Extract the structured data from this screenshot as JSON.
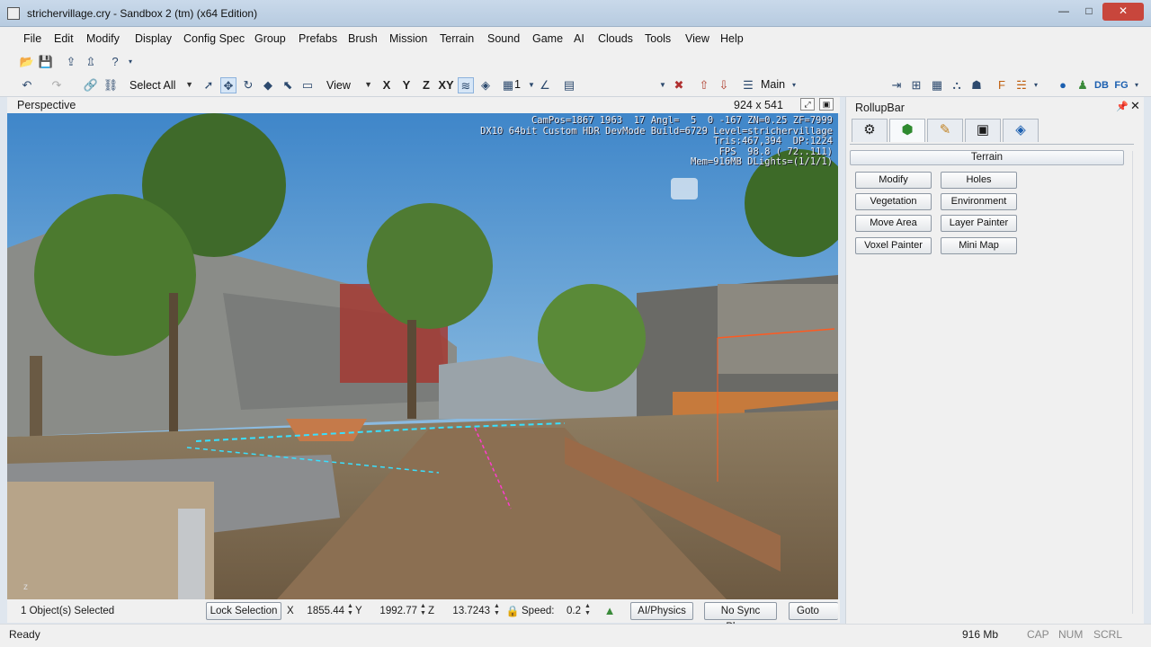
{
  "window": {
    "title": "strichervillage.cry - Sandbox 2 (tm) (x64 Edition)",
    "min_label": "—",
    "max_label": "□",
    "close_label": "✕"
  },
  "menu": {
    "items": [
      "File",
      "Edit",
      "Modify",
      "Display",
      "Config Spec",
      "Group",
      "Prefabs",
      "Brush",
      "Mission",
      "Terrain",
      "Sound",
      "Game",
      "AI",
      "Clouds",
      "Tools",
      "View",
      "Help"
    ]
  },
  "toolbar2": {
    "select_all": "Select All",
    "view": "View",
    "axis_x": "X",
    "axis_y": "Y",
    "axis_z": "Z",
    "axis_xy": "XY",
    "grid_value": "1",
    "layer": "Main",
    "db": "DB",
    "fg": "FG"
  },
  "viewport": {
    "name": "Perspective",
    "resolution": "924 x 541",
    "hud_lines": [
      "CamPos=1867 1963  17 Angl=  5  0 -167 ZN=0.25 ZF=7999",
      "DX10 64bit Custom HDR DevMode Build=6729 Level=strichervillage",
      "Tris:467,394  DP:1224",
      "FPS  98.8 ( 72..111)",
      "Mem=916MB DLights=(1/1/1)"
    ],
    "axis_label": "z"
  },
  "rollup": {
    "title": "RollupBar",
    "section": "Terrain",
    "buttons": [
      "Modify",
      "Holes",
      "Vegetation",
      "Environment",
      "Move Area",
      "Layer Painter",
      "Voxel Painter",
      "Mini Map"
    ],
    "tab_icons": [
      "objects-icon",
      "terrain-icon",
      "modelling-icon",
      "display-icon",
      "layers-icon"
    ]
  },
  "status": {
    "selection": "1 Object(s) Selected",
    "lock_selection": "Lock Selection",
    "x_label": "X",
    "x_value": "1855.44",
    "y_label": "Y",
    "y_value": "1992.77",
    "z_label": "Z",
    "z_value": "13.7243",
    "speed_label": "Speed:",
    "speed_value": "0.2",
    "ai_physics": "AI/Physics",
    "no_sync": "No Sync Player",
    "goto": "Goto posi",
    "ready": "Ready",
    "memory": "916 Mb",
    "cap": "CAP",
    "num": "NUM",
    "scrl": "SCRL"
  }
}
